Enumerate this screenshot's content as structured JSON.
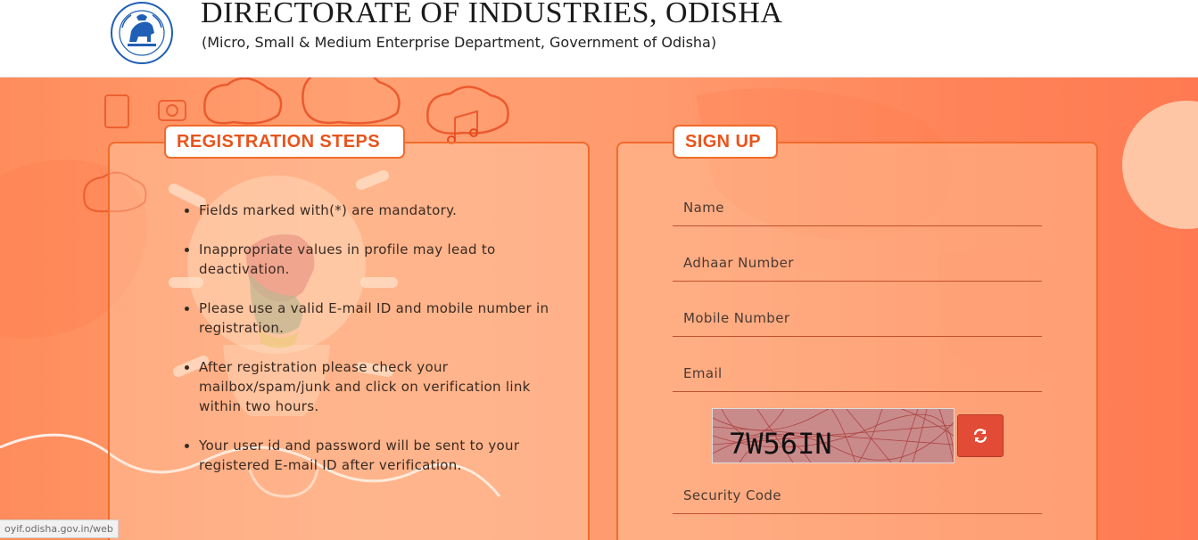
{
  "header": {
    "title": "DIRECTORATE OF INDUSTRIES, ODISHA",
    "subtitle": "(Micro, Small & Medium Enterprise Department, Government of Odisha)",
    "emblem_icon": "odisha-emblem-icon"
  },
  "registration": {
    "heading": "REGISTRATION STEPS",
    "steps": [
      "Fields marked with(*) are mandatory.",
      "Inappropriate values in profile may lead to deactivation.",
      "Please use a valid E-mail ID and mobile number in registration.",
      "After registration please check your mailbox/spam/junk and click on verification link within two hours.",
      "Your user id and password will be sent to your registered E-mail ID after verification."
    ]
  },
  "signup": {
    "heading": "SIGN UP",
    "fields": {
      "name_placeholder": "Name",
      "aadhaar_placeholder": "Adhaar Number",
      "mobile_placeholder": "Mobile Number",
      "email_placeholder": "Email",
      "security_placeholder": "Security Code"
    },
    "captcha_text": "7W56IN",
    "refresh_icon": "refresh-icon"
  },
  "status_bar": {
    "url": "oyif.odisha.gov.in/web"
  },
  "colors": {
    "accent": "#f26b2c",
    "accent_text": "#e8541c",
    "refresh_button": "#e24b35",
    "hero_bg": "#ff9a6e"
  }
}
